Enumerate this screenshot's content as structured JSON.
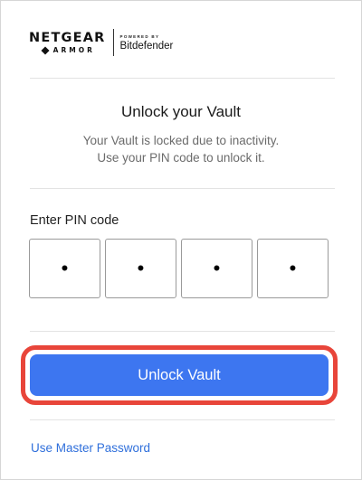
{
  "logo": {
    "brand": "NETGEAR",
    "product": "ARMOR",
    "powered_by": "POWERED BY",
    "partner": "Bitdefender"
  },
  "vault": {
    "title": "Unlock your Vault",
    "subtitle_line1": "Your Vault is locked due to inactivity.",
    "subtitle_line2": "Use your PIN code to unlock it."
  },
  "pin": {
    "label": "Enter PIN code",
    "digits": [
      "•",
      "•",
      "•",
      "•"
    ]
  },
  "actions": {
    "unlock_label": "Unlock Vault",
    "master_password_label": "Use Master Password"
  },
  "colors": {
    "primary_button": "#3d76f0",
    "highlight_outline": "#e8453a",
    "link": "#2f6fdb"
  }
}
